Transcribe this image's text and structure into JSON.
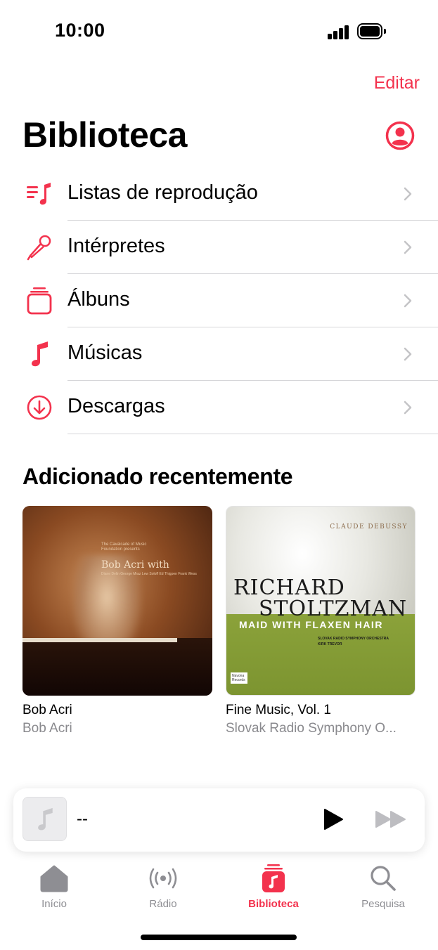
{
  "status_bar": {
    "time": "10:00"
  },
  "header": {
    "edit_label": "Editar",
    "title": "Biblioteca"
  },
  "library_items": [
    {
      "label": "Listas de reprodução",
      "icon": "playlist-icon"
    },
    {
      "label": "Intérpretes",
      "icon": "microphone-icon"
    },
    {
      "label": "Álbuns",
      "icon": "album-stack-icon"
    },
    {
      "label": "Músicas",
      "icon": "music-note-icon"
    },
    {
      "label": "Descargas",
      "icon": "download-icon"
    }
  ],
  "recently_added": {
    "title": "Adicionado recentemente",
    "albums": [
      {
        "title": "Bob Acri",
        "artist": "Bob Acri",
        "cover_text": {
          "presenter": "The Cavalcade of Music Foundation presents",
          "name": "Bob Acri with",
          "guests": "Diane Delin George Mraz Lew Soloff Ed Thigpen Frank Wess"
        }
      },
      {
        "title": "Fine Music, Vol. 1",
        "artist": "Slovak Radio Symphony O...",
        "cover_text": {
          "composer": "CLAUDE DEBUSSY",
          "line1": "RICHARD",
          "line2": "STOLTZMAN",
          "subtitle": "MAID WITH FLAXEN HAIR",
          "orchestra": "SLOVAK RADIO SYMPHONY ORCHESTRA",
          "conductor": "KIRK TREVOR",
          "label": "Navona Records"
        }
      }
    ]
  },
  "mini_player": {
    "title": "--"
  },
  "tabs": [
    {
      "label": "Início",
      "icon": "home-icon",
      "active": false
    },
    {
      "label": "Rádio",
      "icon": "radio-icon",
      "active": false
    },
    {
      "label": "Biblioteca",
      "icon": "library-icon",
      "active": true
    },
    {
      "label": "Pesquisa",
      "icon": "search-icon",
      "active": false
    }
  ],
  "colors": {
    "accent": "#f3324d",
    "secondary_text": "#8a8a8e",
    "tabbar_bg": "#f1f1f2"
  }
}
